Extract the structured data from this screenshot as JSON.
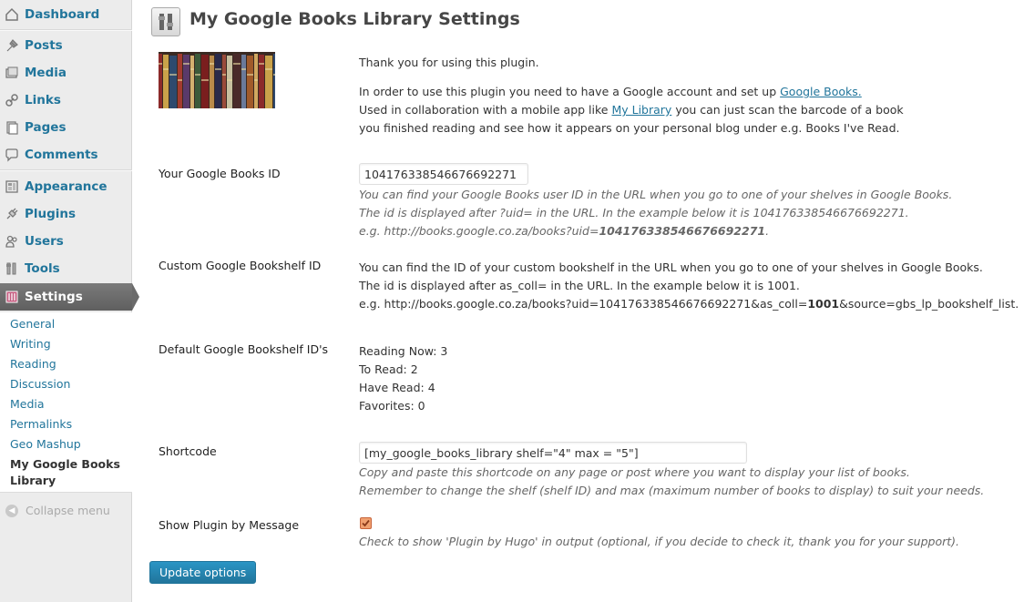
{
  "sidebar": {
    "menu": [
      {
        "label": "Dashboard",
        "icon": "dashboard-icon"
      },
      {
        "label": "Posts",
        "icon": "posts-pin-icon"
      },
      {
        "label": "Media",
        "icon": "media-icon"
      },
      {
        "label": "Links",
        "icon": "links-icon"
      },
      {
        "label": "Pages",
        "icon": "pages-icon"
      },
      {
        "label": "Comments",
        "icon": "comments-icon"
      },
      {
        "label": "Appearance",
        "icon": "appearance-icon"
      },
      {
        "label": "Plugins",
        "icon": "plugins-icon"
      },
      {
        "label": "Users",
        "icon": "users-icon"
      },
      {
        "label": "Tools",
        "icon": "tools-icon"
      },
      {
        "label": "Settings",
        "icon": "settings-icon"
      }
    ],
    "submenu": [
      "General",
      "Writing",
      "Reading",
      "Discussion",
      "Media",
      "Permalinks",
      "Geo Mashup",
      "My Google Books Library"
    ],
    "collapse_label": "Collapse menu"
  },
  "page": {
    "title": "My Google Books Library Settings"
  },
  "intro": {
    "thanks": "Thank you for using this plugin.",
    "line1_prefix": "In order to use this plugin you need to have a Google account and set up ",
    "line1_link": "Google Books.",
    "line2_prefix": "Used in collaboration with a mobile app like ",
    "line2_link": "My Library",
    "line2_suffix": " you can just scan the barcode of a book",
    "line3": "you finished reading and see how it appears on your personal blog under e.g. Books I've Read."
  },
  "books_id": {
    "label": "Your Google Books ID",
    "value": "104176338546676692271",
    "desc1": "You can find your Google Books user ID in the URL when you go to one of your shelves in Google Books.",
    "desc2": "The id is displayed after ?uid= in the URL. In the example below it is 104176338546676692271.",
    "desc3_prefix": "e.g. http://books.google.co.za/books?uid=",
    "desc3_bold": "104176338546676692271",
    "desc3_suffix": "."
  },
  "custom_shelf": {
    "label": "Custom Google Bookshelf ID",
    "line1": "You can find the ID of your custom bookshelf in the URL when you go to one of your shelves in Google Books.",
    "line2": "The id is displayed after as_coll= in the URL. In the example below it is 1001.",
    "line3_prefix": "e.g. http://books.google.co.za/books?uid=104176338546676692271&as_coll=",
    "line3_bold": "1001",
    "line3_suffix": "&source=gbs_lp_bookshelf_list."
  },
  "default_shelves": {
    "label": "Default Google Bookshelf ID's",
    "items": [
      "Reading Now: 3",
      "To Read: 2",
      "Have Read: 4",
      "Favorites: 0"
    ]
  },
  "shortcode": {
    "label": "Shortcode",
    "value": "[my_google_books_library shelf=\"4\" max = \"5\"]",
    "desc1": "Copy and paste this shortcode on any page or post where you want to display your list of books.",
    "desc2": "Remember to change the shelf (shelf ID) and max (maximum number of books to display) to suit your needs."
  },
  "show_plugin": {
    "label": "Show Plugin by Message",
    "checked": true,
    "desc": "Check to show 'Plugin by Hugo' in output (optional, if you decide to check it, thank you for your support)."
  },
  "update_button": "Update options",
  "colors": {
    "link": "#21759b",
    "sidebar_bg": "#ececec",
    "active_menu": "#6b6b6b",
    "button": "#21759b",
    "checkbox": "#f0a070"
  }
}
